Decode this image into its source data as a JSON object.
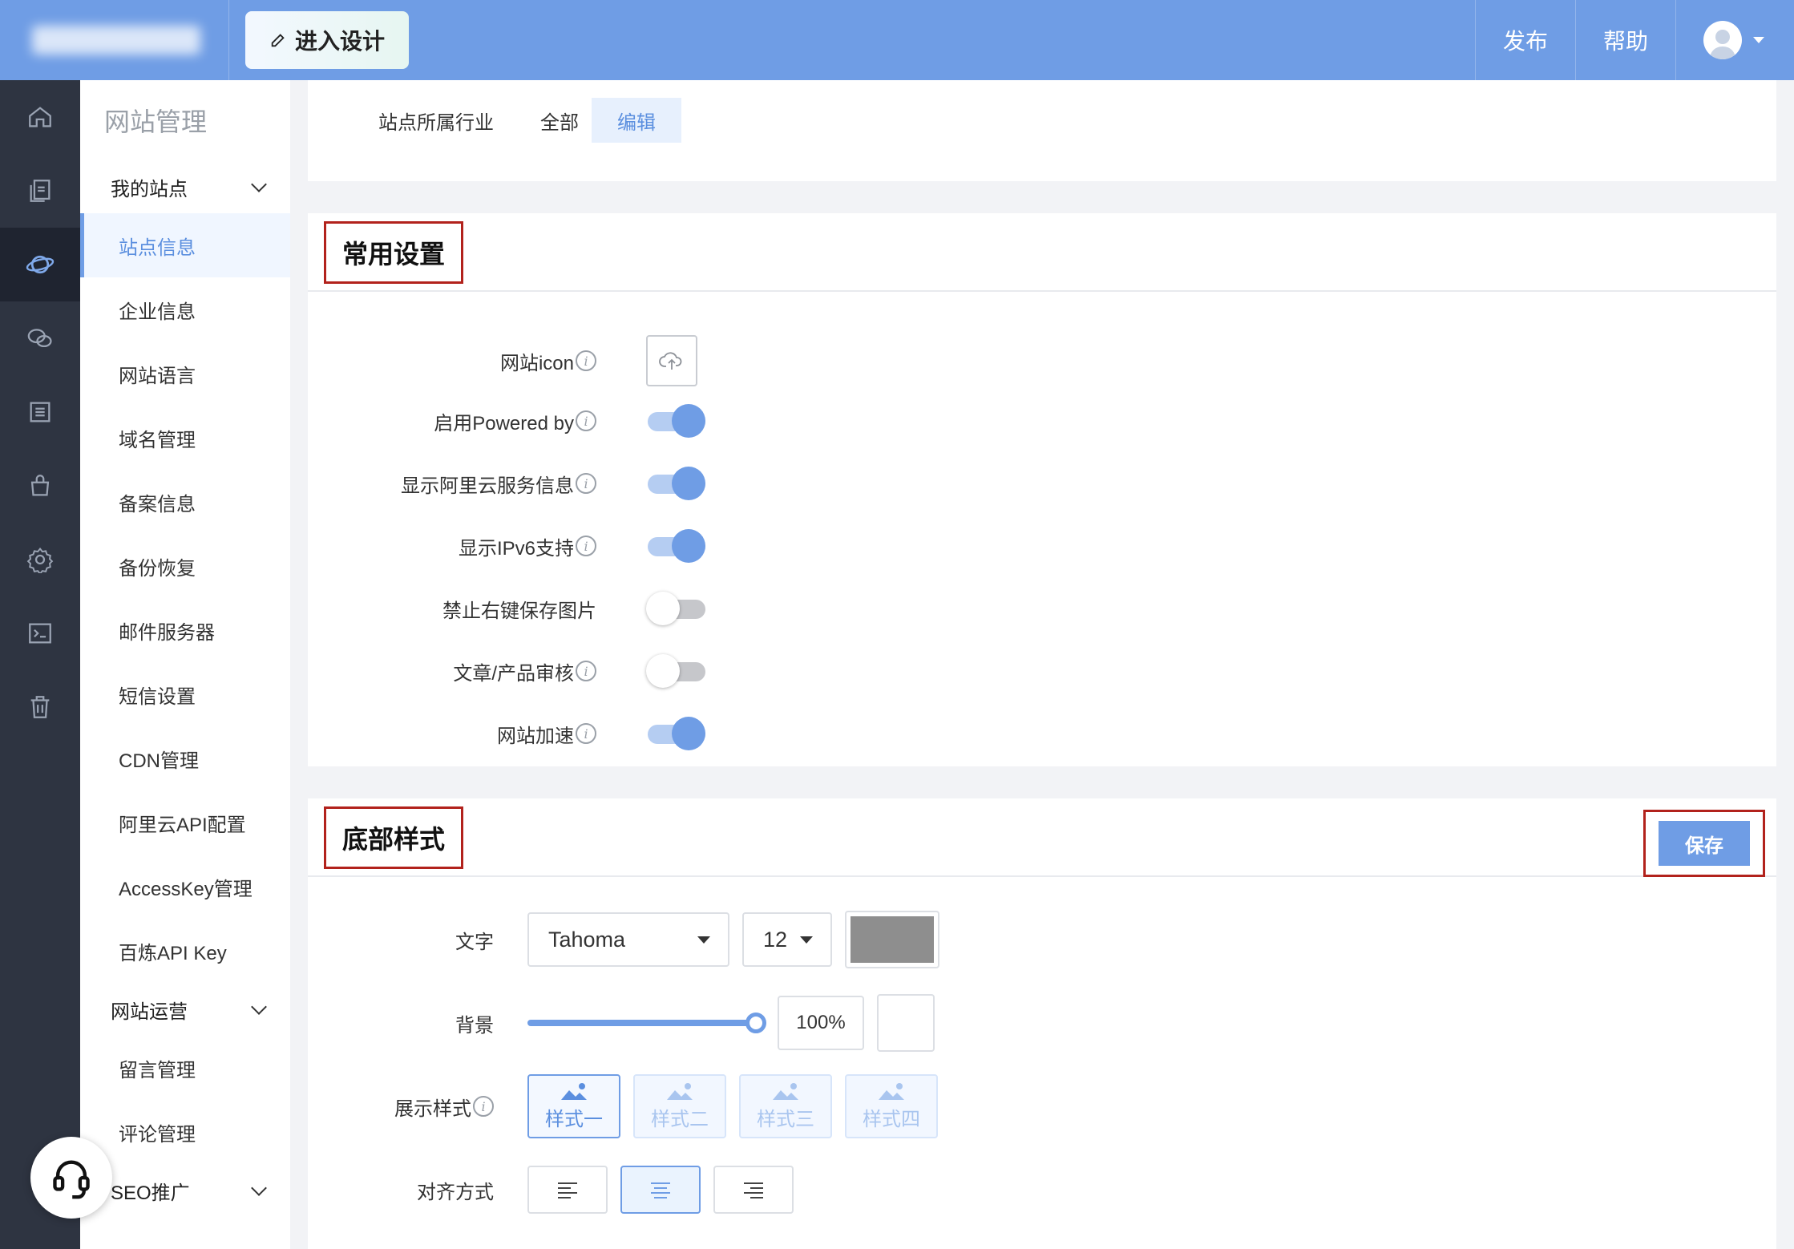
{
  "header": {
    "design_button": "进入设计",
    "publish": "发布",
    "help": "帮助"
  },
  "rail": {
    "icons": [
      "home-icon",
      "pages-icon",
      "planet-icon",
      "wechat-icon",
      "list-icon",
      "bag-icon",
      "gear-icon",
      "terminal-icon",
      "trash-icon"
    ],
    "active_index": 2
  },
  "subnav": {
    "title": "网站管理",
    "group1": "我的站点",
    "items": [
      "站点信息",
      "企业信息",
      "网站语言",
      "域名管理",
      "备案信息",
      "备份恢复",
      "邮件服务器",
      "短信设置",
      "CDN管理",
      "阿里云API配置",
      "AccessKey管理",
      "百炼API Key"
    ],
    "group2": "网站运营",
    "items2": [
      "留言管理",
      "评论管理"
    ],
    "group3": "SEO推广"
  },
  "industry": {
    "label": "站点所属行业",
    "value": "全部",
    "edit": "编辑"
  },
  "common": {
    "title": "常用设置",
    "rows": [
      {
        "label": "网站icon",
        "type": "upload",
        "info": true
      },
      {
        "label": "启用Powered by",
        "type": "toggle",
        "on": true,
        "info": true
      },
      {
        "label": "显示阿里云服务信息",
        "type": "toggle",
        "on": true,
        "info": true
      },
      {
        "label": "显示IPv6支持",
        "type": "toggle",
        "on": true,
        "info": true
      },
      {
        "label": "禁止右键保存图片",
        "type": "toggle",
        "on": false,
        "info": false
      },
      {
        "label": "文章/产品审核",
        "type": "toggle",
        "on": false,
        "info": true
      },
      {
        "label": "网站加速",
        "type": "toggle",
        "on": true,
        "info": true
      }
    ]
  },
  "footer_style": {
    "title": "底部样式",
    "save": "保存",
    "text_label": "文字",
    "font": "Tahoma",
    "size": "12",
    "text_color": "#8e8e8e",
    "bg_label": "背景",
    "bg_opacity": "100%",
    "bg_opacity_value": 1.0,
    "display_label": "展示样式",
    "styles": [
      "样式一",
      "样式二",
      "样式三",
      "样式四"
    ],
    "active_style": 0,
    "align_label": "对齐方式",
    "align_options": [
      "align-left-icon",
      "align-center-icon",
      "align-right-icon"
    ],
    "active_align": 1
  },
  "colors": {
    "accent": "#6f9de5",
    "highlight_border": "#b2221c",
    "rail_bg": "#2e3441"
  }
}
